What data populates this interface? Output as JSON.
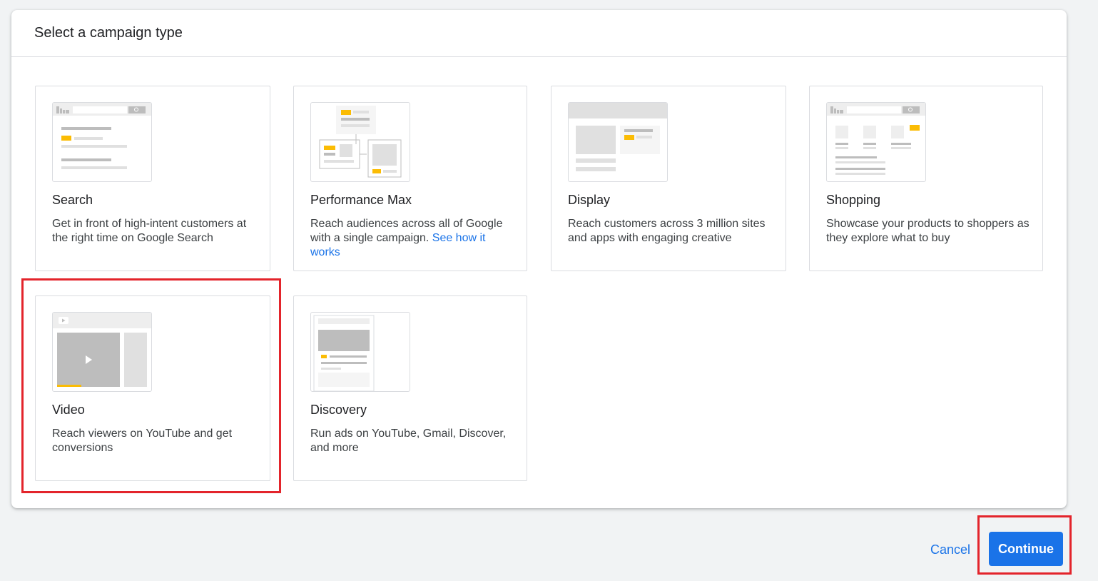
{
  "header": {
    "title": "Select a campaign type"
  },
  "cards": [
    {
      "title": "Search",
      "description": "Get in front of high-intent customers at the right time on Google Search"
    },
    {
      "title": "Performance Max",
      "description": "Reach audiences across all of Google with a single campaign. ",
      "link": "See how it works"
    },
    {
      "title": "Display",
      "description": "Reach customers across 3 million sites and apps with engaging creative"
    },
    {
      "title": "Shopping",
      "description": "Showcase your products to shoppers as they explore what to buy"
    },
    {
      "title": "Video",
      "description": "Reach viewers on YouTube and get conversions"
    },
    {
      "title": "Discovery",
      "description": "Run ads on YouTube, Gmail, Discover, and more"
    }
  ],
  "actions": {
    "cancel_label": "Cancel",
    "continue_label": "Continue"
  },
  "colors": {
    "accent": "#1a73e8",
    "highlight": "#e3242b",
    "illustration_yellow": "#fbbc04",
    "illustration_gray": "#e0e0e0"
  }
}
